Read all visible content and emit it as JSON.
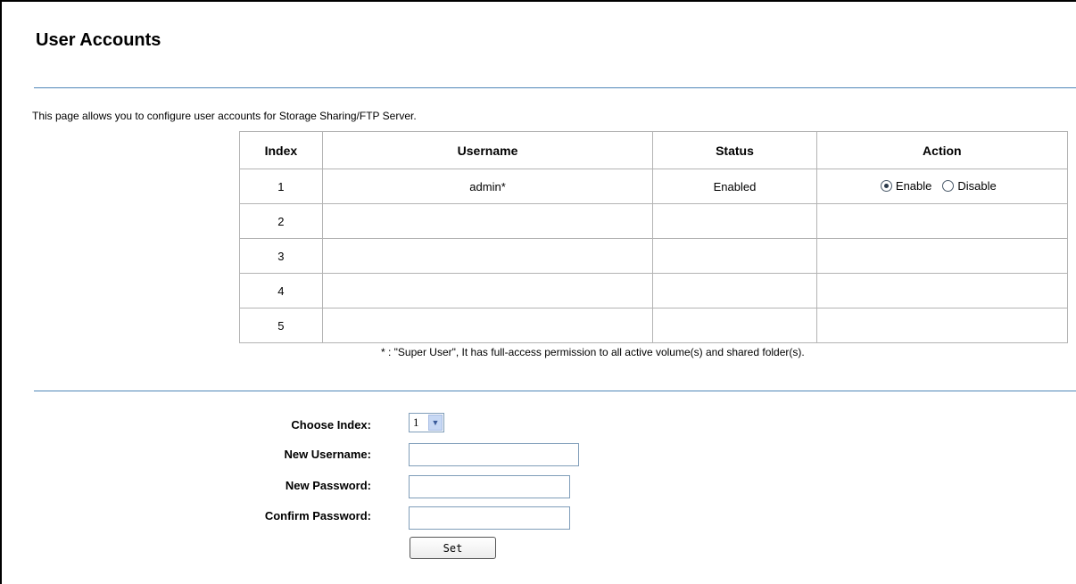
{
  "page": {
    "title": "User Accounts",
    "description": "This page allows you to configure user accounts for Storage Sharing/FTP Server."
  },
  "table": {
    "headers": [
      "Index",
      "Username",
      "Status",
      "Action"
    ],
    "rows": [
      {
        "index": "1",
        "username": "admin*",
        "status": "Enabled",
        "action": {
          "enable_label": "Enable",
          "disable_label": "Disable",
          "selected": "Enable"
        }
      },
      {
        "index": "2",
        "username": "",
        "status": ""
      },
      {
        "index": "3",
        "username": "",
        "status": ""
      },
      {
        "index": "4",
        "username": "",
        "status": ""
      },
      {
        "index": "5",
        "username": "",
        "status": ""
      }
    ],
    "note": "* : \"Super User\", It has full-access permission to all active volume(s) and shared folder(s)."
  },
  "form": {
    "choose_index_label": "Choose Index:",
    "choose_index_value": "1",
    "new_username_label": "New Username:",
    "new_username_value": "",
    "new_password_label": "New Password:",
    "new_password_value": "",
    "confirm_password_label": "Confirm Password:",
    "confirm_password_value": "",
    "set_button": "Set"
  },
  "colors": {
    "divider": "#4f86b8",
    "table_border": "#b3b3b3"
  }
}
